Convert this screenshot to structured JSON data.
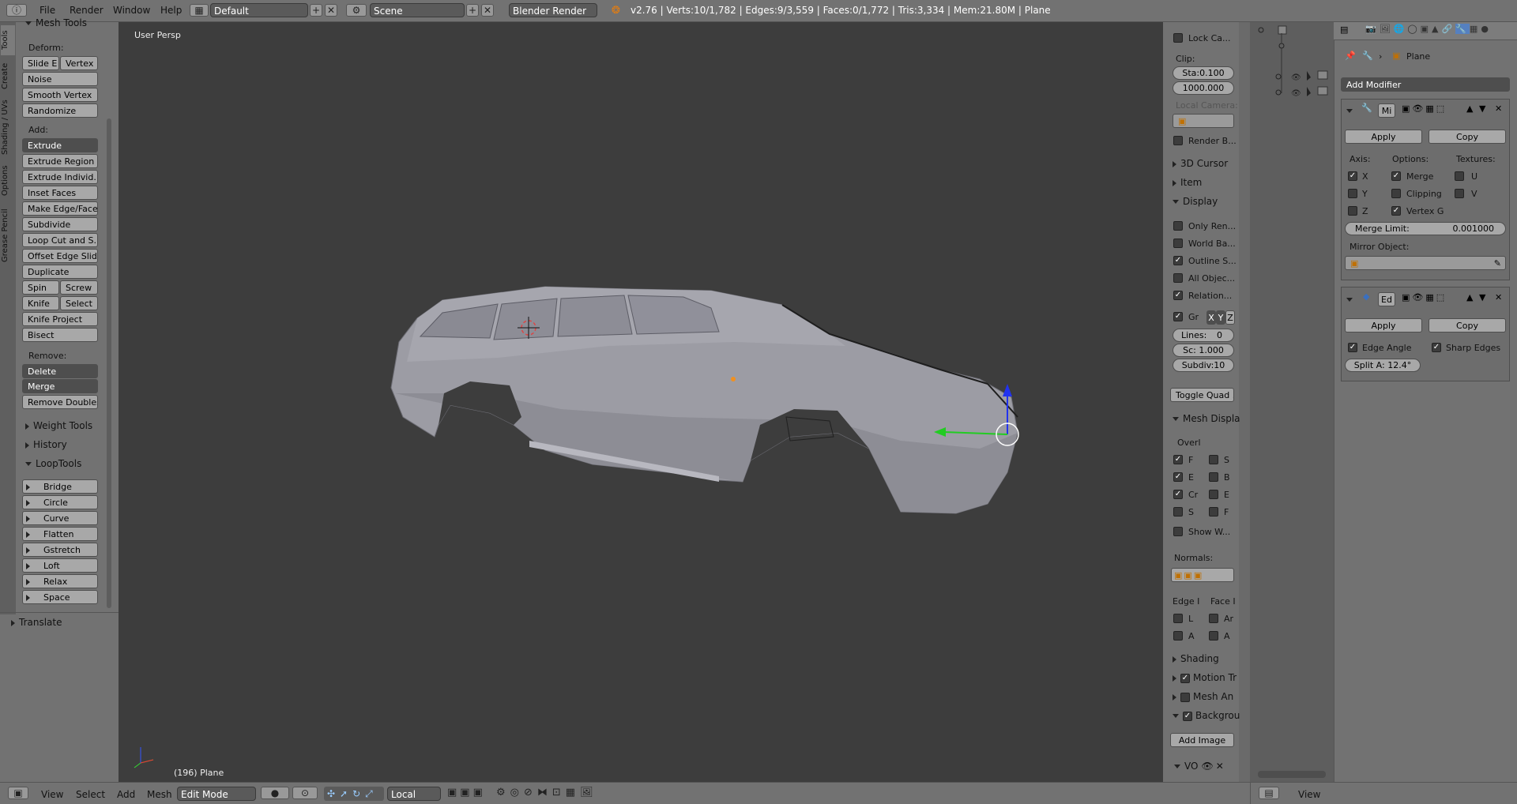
{
  "topbar": {
    "menus": [
      "File",
      "Render",
      "Window",
      "Help"
    ],
    "layout": "Default",
    "scene": "Scene",
    "engine": "Blender Render",
    "stats": "v2.76 | Verts:10/1,782 | Edges:9/3,559 | Faces:0/1,772 | Tris:3,334 | Mem:21.80M | Plane"
  },
  "toolshelf": {
    "tabs": [
      "Tools",
      "Create",
      "Shading / UVs",
      "Options",
      "Grease Pencil"
    ],
    "header": "Mesh Tools",
    "deform_label": "Deform:",
    "deform": [
      [
        "Slide E",
        "Vertex"
      ],
      [
        "Noise"
      ],
      [
        "Smooth Vertex"
      ],
      [
        "Randomize"
      ]
    ],
    "add_label": "Add:",
    "extrude": "Extrude",
    "add": [
      [
        "Extrude Region"
      ],
      [
        "Extrude Individ..."
      ],
      [
        "Inset Faces"
      ],
      [
        "Make Edge/Face"
      ],
      [
        "Subdivide"
      ],
      [
        "Loop Cut and S..."
      ],
      [
        "Offset Edge Slide"
      ],
      [
        "Duplicate"
      ],
      [
        "Spin",
        "Screw"
      ],
      [
        "Knife",
        "Select"
      ],
      [
        "Knife Project"
      ],
      [
        "Bisect"
      ]
    ],
    "remove_label": "Remove:",
    "delete": "Delete",
    "merge": "Merge",
    "remove_doubles": "Remove Doubles",
    "sections": [
      "Weight Tools",
      "History"
    ],
    "looptools": "LoopTools",
    "looptools_items": [
      "Bridge",
      "Circle",
      "Curve",
      "Flatten",
      "Gstretch",
      "Loft",
      "Relax",
      "Space"
    ],
    "translate": "Translate"
  },
  "viewport": {
    "view_label": "User Persp",
    "object_label": "(196) Plane"
  },
  "properties_n": {
    "lock_camera": "Lock Ca...",
    "clip_label": "Clip:",
    "clip_start": "Sta:0.100",
    "clip_end": "1000.000",
    "local_camera": "Local Camera:",
    "render_border": "Render B...",
    "sections_closed": [
      "3D Cursor",
      "Item"
    ],
    "display": "Display",
    "display_items": [
      {
        "label": "Only Ren...",
        "checked": false
      },
      {
        "label": "World Ba...",
        "checked": false
      },
      {
        "label": "Outline S...",
        "checked": true
      },
      {
        "label": "All Objec...",
        "checked": false
      },
      {
        "label": "Relation...",
        "checked": true
      }
    ],
    "grid_label": "Gr",
    "axes": [
      "X",
      "Y",
      "Z"
    ],
    "lines": "Lines:",
    "lines_value": "0",
    "scale": "Sc: 1.000",
    "subdiv": "Subdiv:10",
    "toggle_quad": "Toggle Quad ...",
    "mesh_display": "Mesh Displa",
    "overlays": "Overl",
    "overlay_left": [
      "F",
      "E",
      "Cr",
      "S"
    ],
    "overlay_right": [
      "S",
      "B",
      "E",
      "F"
    ],
    "show_weights": "Show W...",
    "normals": "Normals:",
    "edge_info": "Edge I",
    "face_info": "Face I",
    "edge_items": [
      "L",
      "A"
    ],
    "face_items": [
      "Ar",
      "A"
    ],
    "shading": "Shading",
    "motion_tracking": "Motion Tr",
    "mesh_analysis": "Mesh An",
    "background": "Backgrou",
    "add_image": "Add Image",
    "vo": "VO"
  },
  "modifiers": {
    "breadcrumb": "Plane",
    "add_modifier": "Add Modifier",
    "mirror": {
      "name": "Mi",
      "apply": "Apply",
      "copy": "Copy",
      "axis": "Axis:",
      "options": "Options:",
      "textures": "Textures:",
      "axes": [
        {
          "label": "X",
          "checked": true
        },
        {
          "label": "Y",
          "checked": false
        },
        {
          "label": "Z",
          "checked": false
        }
      ],
      "opts": [
        {
          "label": "Merge",
          "checked": true
        },
        {
          "label": "Clipping",
          "checked": false
        },
        {
          "label": "Vertex G",
          "checked": true
        }
      ],
      "tex": [
        {
          "label": "U",
          "checked": false
        },
        {
          "label": "V",
          "checked": false
        }
      ],
      "merge_limit": "Merge Limit:",
      "merge_limit_value": "0.001000",
      "mirror_object": "Mirror Object:"
    },
    "edgesplit": {
      "name": "Ed",
      "apply": "Apply",
      "copy": "Copy",
      "edge_angle": "Edge Angle",
      "sharp_edges": "Sharp Edges",
      "split_angle": "Split A: 12.4°"
    }
  },
  "bottombar": {
    "menus": [
      "View",
      "Select",
      "Add",
      "Mesh"
    ],
    "mode": "Edit Mode",
    "orientation": "Local",
    "right_view": "View"
  }
}
